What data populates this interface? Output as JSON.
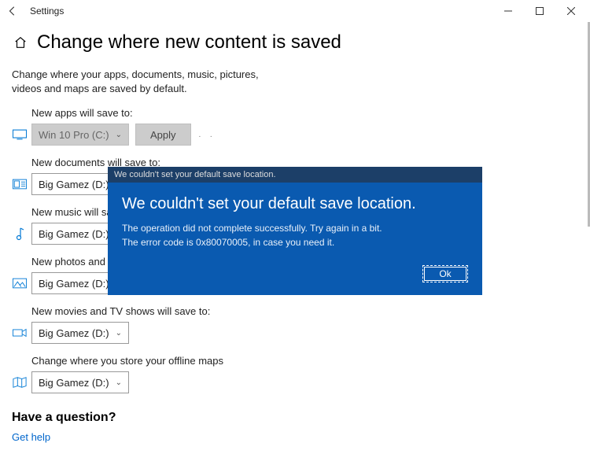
{
  "window": {
    "title": "Settings"
  },
  "page": {
    "title": "Change where new content is saved",
    "intro": "Change where your apps, documents, music, pictures, videos and maps are saved by default."
  },
  "sections": {
    "apps": {
      "label": "New apps will save to:",
      "value": "Win 10 Pro (C:)",
      "apply": "Apply"
    },
    "documents": {
      "label": "New documents will save to:",
      "value": "Big Gamez (D:)"
    },
    "music": {
      "label": "New music will save to:",
      "value": "Big Gamez (D:)"
    },
    "photos": {
      "label": "New photos and videos will save to:",
      "value": "Big Gamez (D:)"
    },
    "movies": {
      "label": "New movies and TV shows will save to:",
      "value": "Big Gamez (D:)"
    },
    "maps": {
      "label": "Change where you store your offline maps",
      "value": "Big Gamez (D:)"
    }
  },
  "question": {
    "heading": "Have a question?",
    "link": "Get help"
  },
  "dialog": {
    "header": "We couldn't set your default save location.",
    "title": "We couldn't set your default save location.",
    "line1": "The operation did not complete successfully. Try again in a bit.",
    "line2": "The error code is 0x80070005, in case you need it.",
    "ok": "Ok"
  }
}
